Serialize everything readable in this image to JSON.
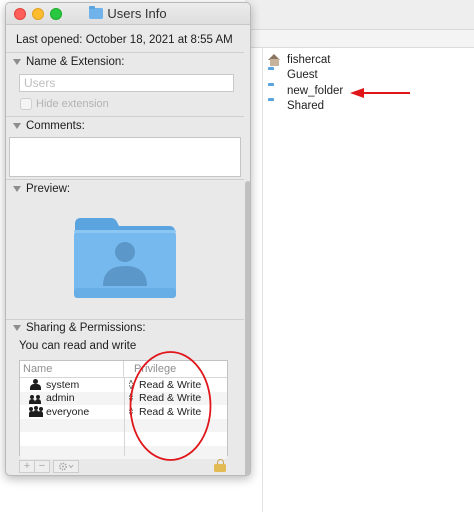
{
  "window": {
    "title": "Users Info",
    "last_opened": "Last opened: October 18, 2021 at 8:55 AM"
  },
  "sections": {
    "name_extension": "Name & Extension:",
    "comments": "Comments:",
    "preview": "Preview:",
    "sharing": "Sharing & Permissions:"
  },
  "name_field": {
    "placeholder": "Users",
    "value": ""
  },
  "hide_extension": {
    "label": "Hide extension",
    "checked": false
  },
  "permissions": {
    "summary": "You can read and write",
    "columns": [
      "Name",
      "Privilege"
    ],
    "rows": [
      {
        "name": "system",
        "privilege": "Read & Write"
      },
      {
        "name": "admin",
        "privilege": "Read & Write"
      },
      {
        "name": "everyone",
        "privilege": "Read & Write"
      }
    ],
    "add_label": "+",
    "remove_label": "−"
  },
  "finder": {
    "items": [
      {
        "name": "fishercat",
        "icon": "home-folder-icon"
      },
      {
        "name": "Guest",
        "icon": "folder-icon"
      },
      {
        "name": "new_folder",
        "icon": "folder-icon"
      },
      {
        "name": "Shared",
        "icon": "folder-icon"
      }
    ]
  },
  "colors": {
    "folder_blue": "#6fb3ea",
    "annotation_red": "#e0161b",
    "close": "#fe5f57",
    "minimize": "#febb2e",
    "zoom": "#28c840"
  }
}
